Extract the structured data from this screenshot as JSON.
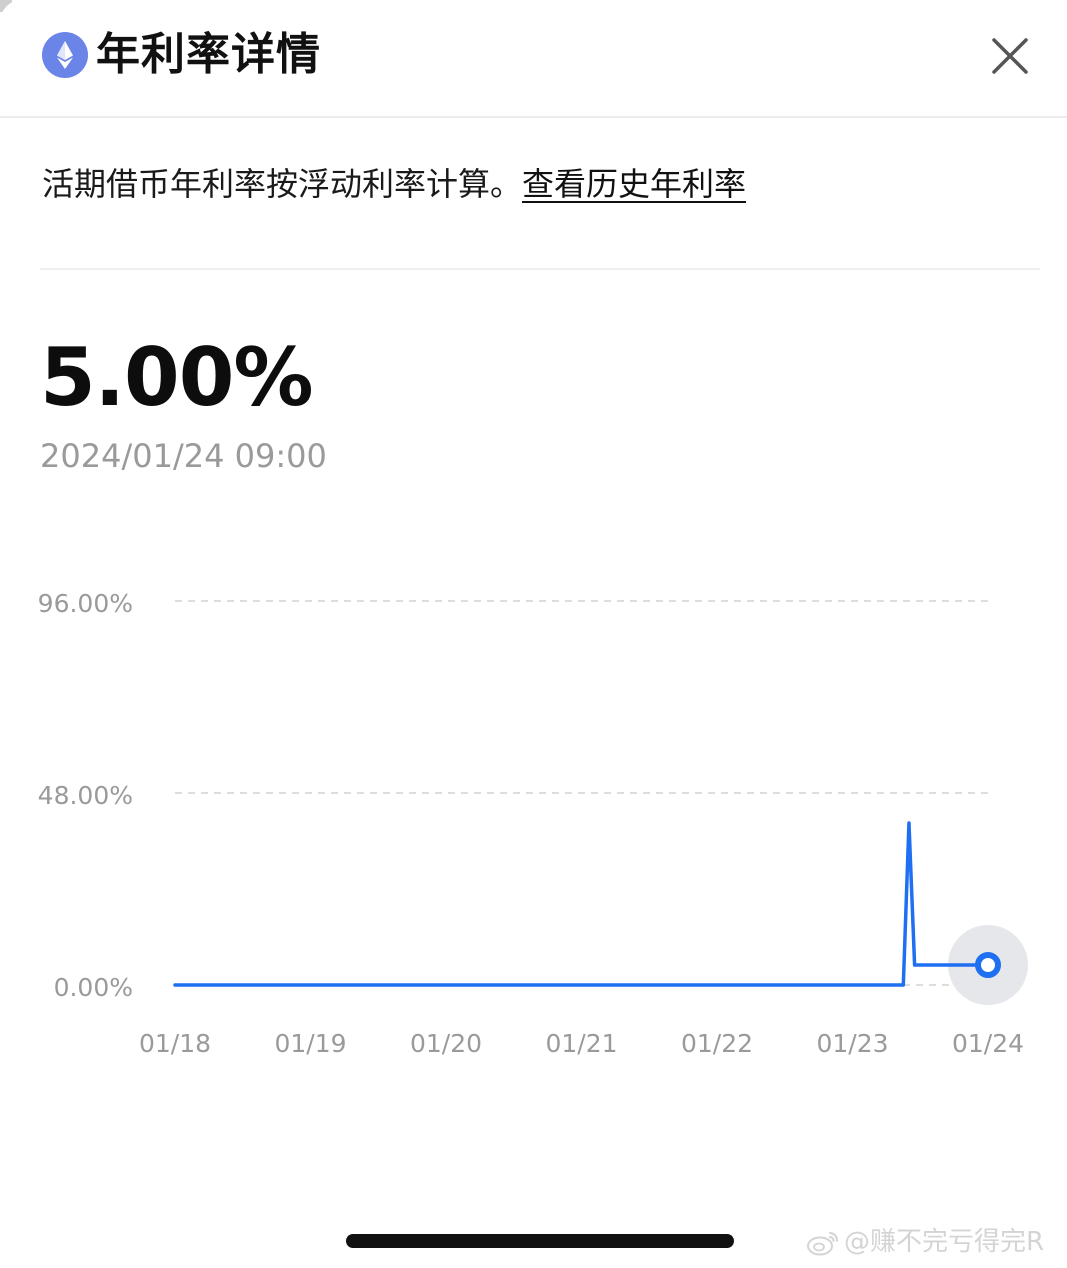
{
  "header": {
    "coin_icon": "ethereum-icon",
    "title": "年利率详情",
    "close_icon": "close-icon"
  },
  "description": {
    "text": "活期借币年利率按浮动利率计算。",
    "link_text": "查看历史年利率"
  },
  "current": {
    "rate": "5.00%",
    "timestamp": "2024/01/24 09:00"
  },
  "chart_data": {
    "type": "line",
    "title": "",
    "xlabel": "",
    "ylabel": "",
    "x_ticks": [
      "01/18",
      "01/19",
      "01/20",
      "01/21",
      "01/22",
      "01/23",
      "01/24"
    ],
    "y_ticks": [
      "96.00%",
      "48.00%",
      "0.00%"
    ],
    "ylim": [
      0,
      96
    ],
    "grid": "horizontal dashed",
    "series": [
      {
        "color": "#1f6ff2",
        "points": [
          {
            "x": "01/18 09:00",
            "y": 0
          },
          {
            "x": "01/19 09:00",
            "y": 0
          },
          {
            "x": "01/20 09:00",
            "y": 0
          },
          {
            "x": "01/21 09:00",
            "y": 0
          },
          {
            "x": "01/22 09:00",
            "y": 0
          },
          {
            "x": "01/23 09:00",
            "y": 0
          },
          {
            "x": "01/23 18:00",
            "y": 0
          },
          {
            "x": "01/23 19:00",
            "y": 40.5
          },
          {
            "x": "01/23 20:00",
            "y": 5
          },
          {
            "x": "01/24 09:00",
            "y": 5
          }
        ]
      }
    ],
    "highlighted_point": {
      "x": "01/24 09:00",
      "y": 5
    }
  },
  "watermark": {
    "logo": "weibo-icon",
    "text": "@赚不完亏得完R"
  }
}
